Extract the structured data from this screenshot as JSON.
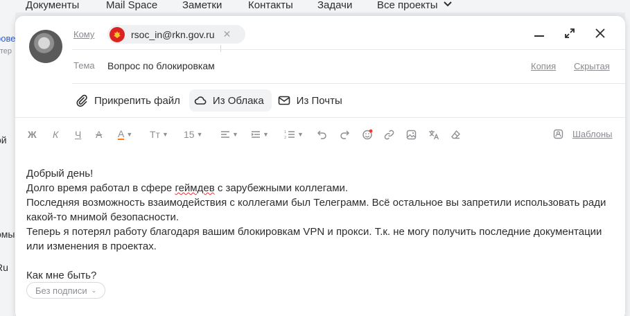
{
  "nav": {
    "items": [
      "Документы",
      "Mail Space",
      "Заметки",
      "Контакты",
      "Задачи",
      "Все проекты"
    ]
  },
  "background": {
    "left_fragments": [
      "ровей",
      "отер",
      "ой",
      "омы",
      "Ru"
    ]
  },
  "compose": {
    "to_label": "Кому",
    "recipient": "rsoc_in@rkn.gov.ru",
    "subject_label": "Тема",
    "subject": "Вопрос по блокировкам",
    "cc_label": "Копия",
    "bcc_label": "Скрытая",
    "attach": {
      "file": "Прикрепить файл",
      "cloud": "Из Облака",
      "mail": "Из Почты"
    },
    "toolbar": {
      "bold": "Ж",
      "italic": "К",
      "underline": "Ч",
      "strike": "А",
      "color": "А",
      "font": "Тт",
      "size": "15",
      "templates": "Шаблоны"
    },
    "body": {
      "greeting": "Добрый день!",
      "line2_a": "Долго время работал в сфере ",
      "line2_misspelled": "геймдев",
      "line2_b": " с зарубежными коллегами.",
      "line3": "Последняя возможность взаимодействия с коллегами был Телеграмм. Всё остальное вы запретили использовать ради",
      "line4": "какой-то мнимой безопасности.",
      "line5": "Теперь я потерял работу благодаря вашим блокировкам VPN и прокси. Т.к. не могу получить последние документации",
      "line6": "или изменения в проектах.",
      "question": "Как мне быть?"
    },
    "signature": "Без подписи"
  },
  "colors": {
    "accent": "#2c2d2e",
    "muted": "#878b91",
    "spellcheck": "#e0313a",
    "emblem": "#dd2222",
    "emoji_badge": "#ff3333"
  }
}
